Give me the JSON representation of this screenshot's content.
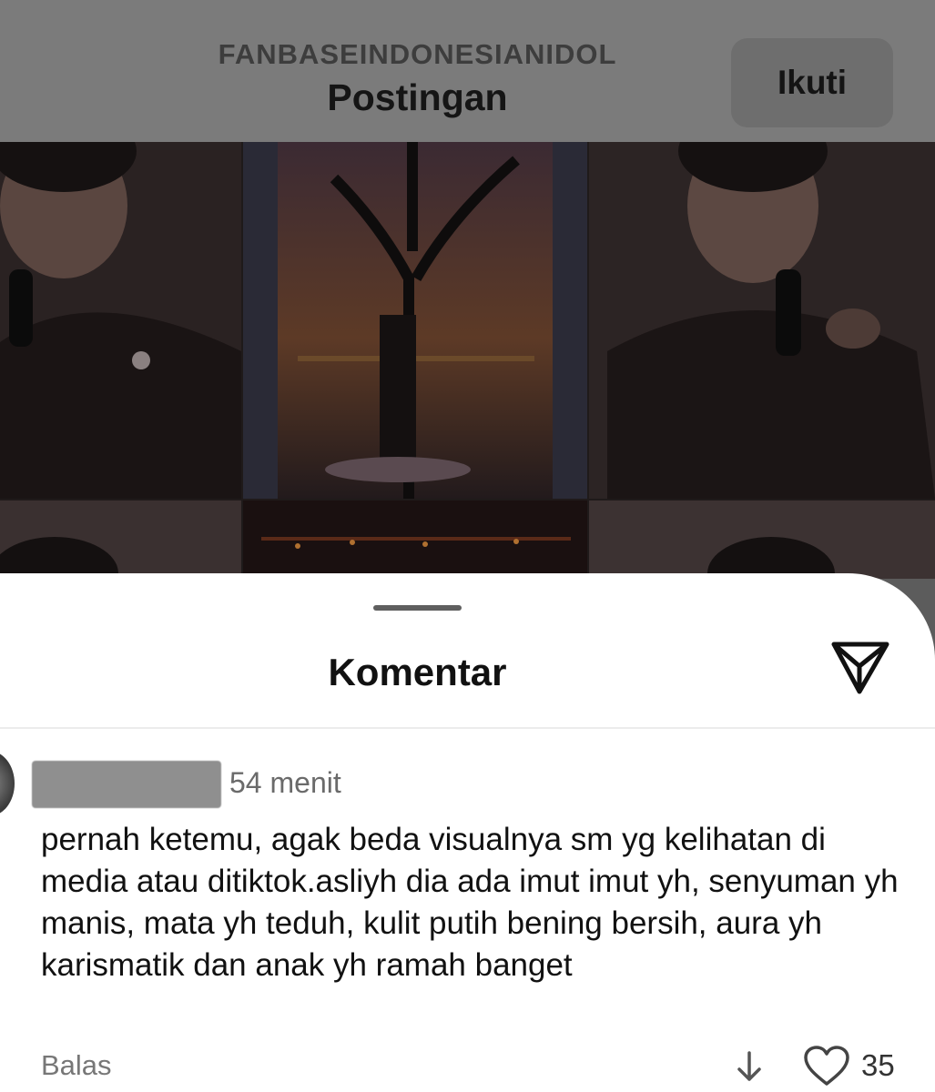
{
  "header": {
    "username": "FANBASEINDONESIANIDOL",
    "title": "Postingan",
    "follow_label": "Ikuti"
  },
  "sheet": {
    "title": "Komentar"
  },
  "comment": {
    "time": "54 menit",
    "text": "pernah ketemu, agak beda  visualnya sm yg kelihatan di media atau ditiktok.asliyh dia ada imut imut yh, senyuman yh manis, mata yh teduh, kulit putih bening bersih, aura yh karismatik dan anak yh ramah banget",
    "reply_label": "Balas",
    "like_count": "35"
  },
  "icons": [
    "share-icon",
    "downvote-icon",
    "heart-icon"
  ],
  "colors": {
    "dim_overlay": "#7b7b7b",
    "sheet_bg": "#ffffff",
    "text": "#111111",
    "muted": "#777777"
  }
}
